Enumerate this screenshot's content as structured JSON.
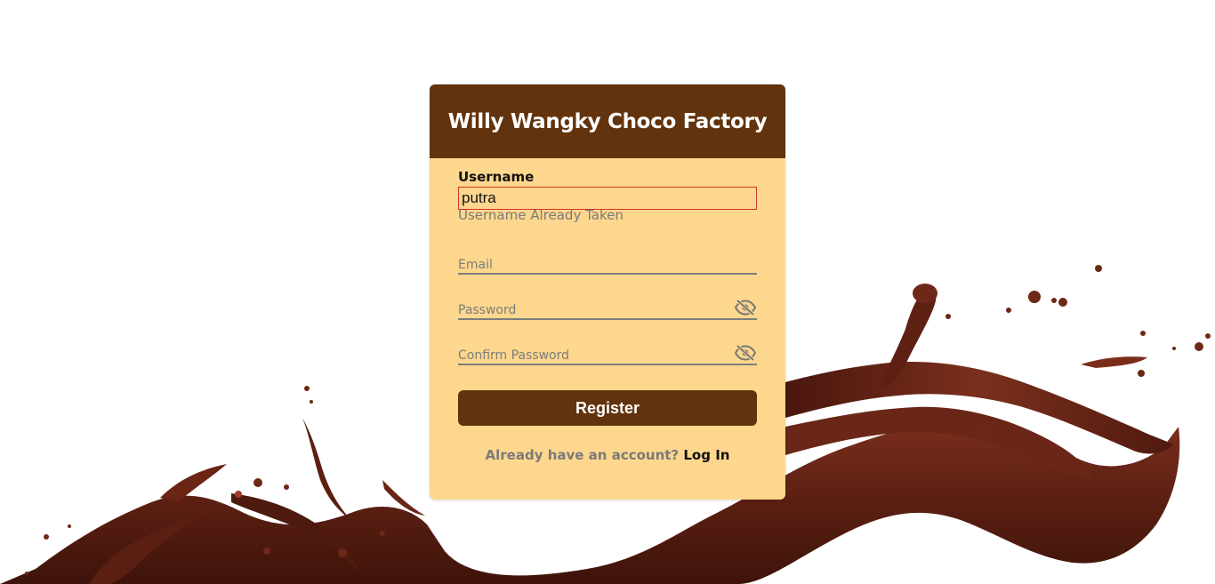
{
  "app": {
    "title": "Willy Wangky Choco Factory"
  },
  "form": {
    "username": {
      "label": "Username",
      "value": "putra",
      "error": "Username Already Taken"
    },
    "email": {
      "placeholder": "Email",
      "value": ""
    },
    "password": {
      "placeholder": "Password",
      "value": ""
    },
    "confirm_password": {
      "placeholder": "Confirm Password",
      "value": ""
    },
    "register_label": "Register"
  },
  "footer": {
    "prompt": "Already have an account?",
    "login_label": "Log In"
  },
  "colors": {
    "header_bg": "#62330c",
    "card_bg": "#fdd78d",
    "button_bg": "#62330c",
    "error_border": "#d0342c",
    "chocolate": "#5a1f12"
  },
  "icons": {
    "password_toggle": "eye-slash-icon",
    "confirm_password_toggle": "eye-slash-icon",
    "background": "chocolate-splash"
  }
}
